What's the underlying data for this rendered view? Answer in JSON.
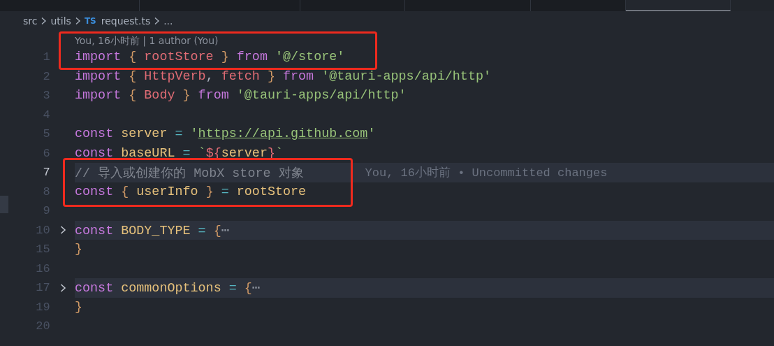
{
  "tabs": [
    {
      "selected": false
    },
    {
      "selected": false
    },
    {
      "selected": false
    },
    {
      "selected": false
    },
    {
      "selected": false
    },
    {
      "selected": true
    }
  ],
  "breadcrumb": [
    {
      "kind": "folder",
      "text": "src"
    },
    {
      "kind": "folder",
      "text": "utils"
    },
    {
      "kind": "file",
      "badge": "TS",
      "text": "request.ts"
    },
    {
      "kind": "more",
      "text": "..."
    }
  ],
  "editor": {
    "blocks": [
      {
        "kind": "box",
        "rows": [
          {
            "kind": "lens",
            "text": "You, 16小时前 | 1 author (You)"
          },
          {
            "kind": "line",
            "number": "1",
            "current": false,
            "folded": false,
            "tokens": [
              {
                "kind": "keyword",
                "text": "import"
              },
              {
                "kind": "punct",
                "text": " {"
              },
              {
                "kind": "name",
                "text": " rootStore"
              },
              {
                "kind": "punct",
                "text": " }"
              },
              {
                "kind": "keyword",
                "text": " from"
              },
              {
                "kind": "string",
                "text": " '@/store'"
              }
            ]
          }
        ]
      },
      {
        "kind": "line",
        "number": "2",
        "current": false,
        "folded": false,
        "tokens": [
          {
            "kind": "keyword",
            "text": "import"
          },
          {
            "kind": "punct",
            "text": " {"
          },
          {
            "kind": "name",
            "text": " HttpVerb"
          },
          {
            "kind": "plain",
            "text": ","
          },
          {
            "kind": "name",
            "text": " fetch"
          },
          {
            "kind": "punct",
            "text": " }"
          },
          {
            "kind": "keyword",
            "text": " from"
          },
          {
            "kind": "string",
            "text": " '@tauri-apps/api/http'"
          }
        ]
      },
      {
        "kind": "line",
        "number": "3",
        "current": false,
        "folded": false,
        "tokens": [
          {
            "kind": "keyword",
            "text": "import"
          },
          {
            "kind": "punct",
            "text": " {"
          },
          {
            "kind": "name",
            "text": " Body"
          },
          {
            "kind": "punct",
            "text": " }"
          },
          {
            "kind": "keyword",
            "text": " from"
          },
          {
            "kind": "string",
            "text": " '@tauri-apps/api/http'"
          }
        ]
      },
      {
        "kind": "line",
        "number": "4",
        "current": false,
        "folded": false
      },
      {
        "kind": "line",
        "number": "5",
        "current": false,
        "folded": false,
        "tokens": [
          {
            "kind": "keyword",
            "text": "const"
          },
          {
            "kind": "variable",
            "text": " server"
          },
          {
            "kind": "operator",
            "text": " ="
          },
          {
            "kind": "string",
            "text": " '"
          },
          {
            "kind": "link",
            "text": "https://api.github.com"
          },
          {
            "kind": "string",
            "text": "'"
          }
        ]
      },
      {
        "kind": "line",
        "number": "6",
        "current": false,
        "folded": false,
        "tokens": [
          {
            "kind": "keyword",
            "text": "const"
          },
          {
            "kind": "variable",
            "text": " baseURL"
          },
          {
            "kind": "operator",
            "text": " ="
          },
          {
            "kind": "string",
            "text": " `"
          },
          {
            "kind": "name",
            "text": "${"
          },
          {
            "kind": "variable",
            "text": "server"
          },
          {
            "kind": "name",
            "text": "}"
          },
          {
            "kind": "string",
            "text": "`"
          }
        ]
      },
      {
        "kind": "box",
        "rows": [
          {
            "kind": "line",
            "number": "7",
            "current": true,
            "folded": false,
            "blame": "You, 16小时前 • Uncommitted changes",
            "tokens": [
              {
                "kind": "comment",
                "text": "// 导入或创建你的 MobX store 对象"
              }
            ]
          },
          {
            "kind": "line",
            "number": "8",
            "current": false,
            "folded": false,
            "tokens": [
              {
                "kind": "keyword",
                "text": "const"
              },
              {
                "kind": "punct",
                "text": " {"
              },
              {
                "kind": "variable",
                "text": " userInfo"
              },
              {
                "kind": "punct",
                "text": " }"
              },
              {
                "kind": "operator",
                "text": " ="
              },
              {
                "kind": "variable",
                "text": " rootStore"
              }
            ]
          }
        ]
      },
      {
        "kind": "line",
        "number": "9",
        "current": false,
        "folded": false
      },
      {
        "kind": "line",
        "number": "10",
        "current": false,
        "folded": true,
        "tokens": [
          {
            "kind": "keyword",
            "text": "const"
          },
          {
            "kind": "variable",
            "text": " BODY_TYPE"
          },
          {
            "kind": "operator",
            "text": " ="
          },
          {
            "kind": "punct",
            "text": " {"
          },
          {
            "kind": "fold",
            "text": "⋯"
          }
        ]
      },
      {
        "kind": "line",
        "number": "15",
        "current": false,
        "folded": false,
        "tokens": [
          {
            "kind": "punct",
            "text": "}"
          }
        ]
      },
      {
        "kind": "line",
        "number": "16",
        "current": false,
        "folded": false
      },
      {
        "kind": "line",
        "number": "17",
        "current": false,
        "folded": true,
        "tokens": [
          {
            "kind": "keyword",
            "text": "const"
          },
          {
            "kind": "variable",
            "text": " commonOptions"
          },
          {
            "kind": "operator",
            "text": " ="
          },
          {
            "kind": "punct",
            "text": " {"
          },
          {
            "kind": "fold",
            "text": "⋯"
          }
        ]
      },
      {
        "kind": "line",
        "number": "19",
        "current": false,
        "folded": false,
        "tokens": [
          {
            "kind": "punct",
            "text": "}"
          }
        ]
      },
      {
        "kind": "line",
        "number": "20",
        "current": false,
        "folded": false
      }
    ]
  }
}
